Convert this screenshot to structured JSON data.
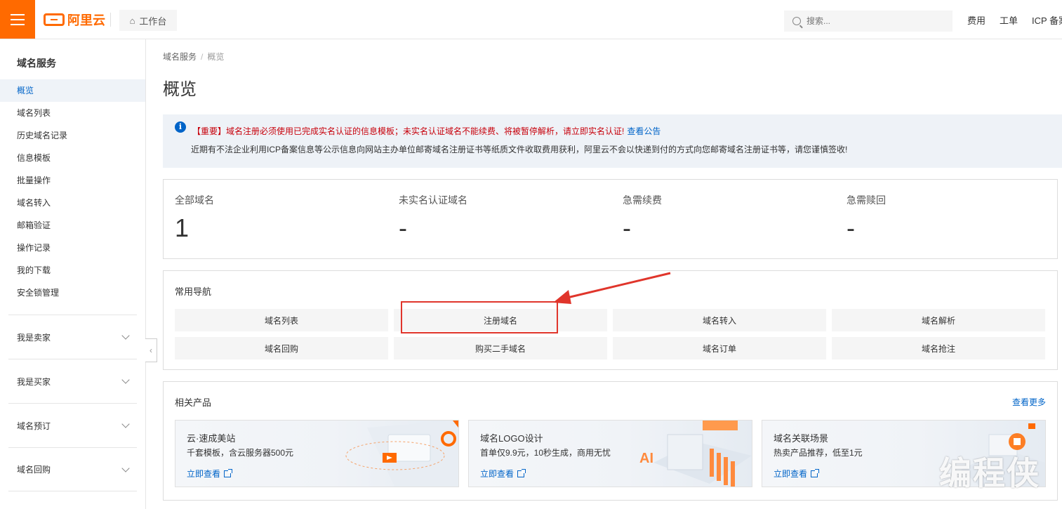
{
  "topbar": {
    "logo_text": "阿里云",
    "workbench_label": "工作台",
    "search_placeholder": "搜索...",
    "links": [
      "费用",
      "工单",
      "ICP 备案"
    ]
  },
  "sidebar": {
    "title": "域名服务",
    "items": [
      {
        "label": "概览",
        "active": true
      },
      {
        "label": "域名列表"
      },
      {
        "label": "历史域名记录"
      },
      {
        "label": "信息模板"
      },
      {
        "label": "批量操作"
      },
      {
        "label": "域名转入"
      },
      {
        "label": "邮箱验证"
      },
      {
        "label": "操作记录"
      },
      {
        "label": "我的下载"
      },
      {
        "label": "安全锁管理"
      }
    ],
    "groups": [
      "我是卖家",
      "我是买家",
      "域名预订",
      "域名回购"
    ]
  },
  "breadcrumb": {
    "root": "域名服务",
    "current": "概览"
  },
  "page_title": "概览",
  "notice": {
    "line1": "【重要】域名注册必须使用已完成实名认证的信息模板；未实名认证域名不能续费、将被暂停解析，请立即实名认证!",
    "line1_link": "查看公告",
    "line2": "近期有不法企业利用ICP备案信息等公示信息向网站主办单位邮寄域名注册证书等纸质文件收取费用获利，阿里云不会以快递到付的方式向您邮寄域名注册证书等，请您谨慎签收!"
  },
  "stats": [
    {
      "label": "全部域名",
      "value": "1"
    },
    {
      "label": "未实名认证域名",
      "value": "-"
    },
    {
      "label": "急需续费",
      "value": "-"
    },
    {
      "label": "急需赎回",
      "value": "-"
    }
  ],
  "common_nav": {
    "title": "常用导航",
    "buttons": [
      "域名列表",
      "注册域名",
      "域名转入",
      "域名解析",
      "域名回购",
      "购买二手域名",
      "域名订单",
      "域名抢注"
    ],
    "highlighted": "注册域名"
  },
  "related": {
    "title": "相关产品",
    "more": "查看更多",
    "cards": [
      {
        "title": "云·速成美站",
        "desc": "千套模板，含云服务器500元",
        "link": "立即查看"
      },
      {
        "title": "域名LOGO设计",
        "desc": "首单仅9.9元，10秒生成，商用无忧",
        "link": "立即查看",
        "art_text": "AI"
      },
      {
        "title": "域名关联场景",
        "desc": "热卖产品推荐，低至1元",
        "link": "立即查看"
      }
    ]
  },
  "watermark": "编程侠",
  "colors": {
    "brand": "#ff6a00",
    "link": "#0064c8",
    "alert": "#c7000b",
    "annotation": "#e0352b"
  }
}
